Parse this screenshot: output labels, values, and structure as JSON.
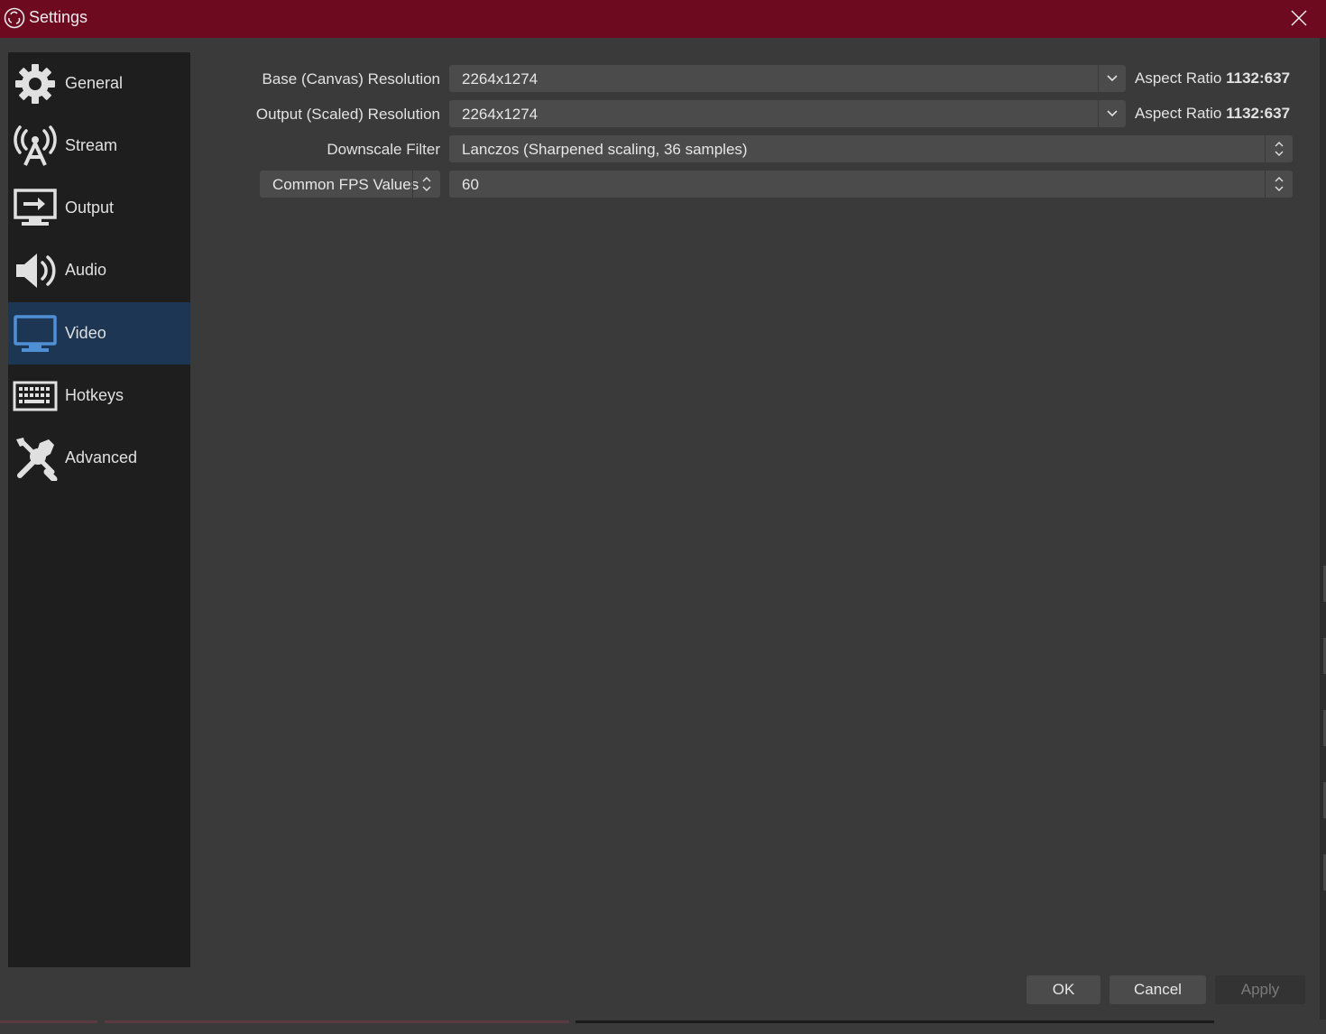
{
  "window": {
    "title": "Settings",
    "close_icon": "close-icon",
    "titlebar_color": "#6d0a20"
  },
  "sidebar": {
    "active": "Video",
    "items": [
      {
        "label": "General",
        "icon": "gear-icon"
      },
      {
        "label": "Stream",
        "icon": "antenna-icon"
      },
      {
        "label": "Output",
        "icon": "output-monitor-icon"
      },
      {
        "label": "Audio",
        "icon": "speaker-icon"
      },
      {
        "label": "Video",
        "icon": "monitor-icon"
      },
      {
        "label": "Hotkeys",
        "icon": "keyboard-icon"
      },
      {
        "label": "Advanced",
        "icon": "tools-icon"
      }
    ]
  },
  "video": {
    "base_resolution": {
      "label": "Base (Canvas) Resolution",
      "value": "2264x1274",
      "aspect_label": "Aspect Ratio",
      "aspect_value": "1132:637"
    },
    "output_resolution": {
      "label": "Output (Scaled) Resolution",
      "value": "2264x1274",
      "aspect_label": "Aspect Ratio",
      "aspect_value": "1132:637"
    },
    "downscale_filter": {
      "label": "Downscale Filter",
      "value": "Lanczos (Sharpened scaling, 36 samples)"
    },
    "fps": {
      "type_label": "Common FPS Values",
      "value": "60"
    }
  },
  "buttons": {
    "ok": "OK",
    "cancel": "Cancel",
    "apply": "Apply"
  },
  "colors": {
    "accent_active": "#1d3654",
    "active_icon": "#4f8fd6",
    "background": "#3a3a3a",
    "sidebar": "#1e1e1e"
  }
}
